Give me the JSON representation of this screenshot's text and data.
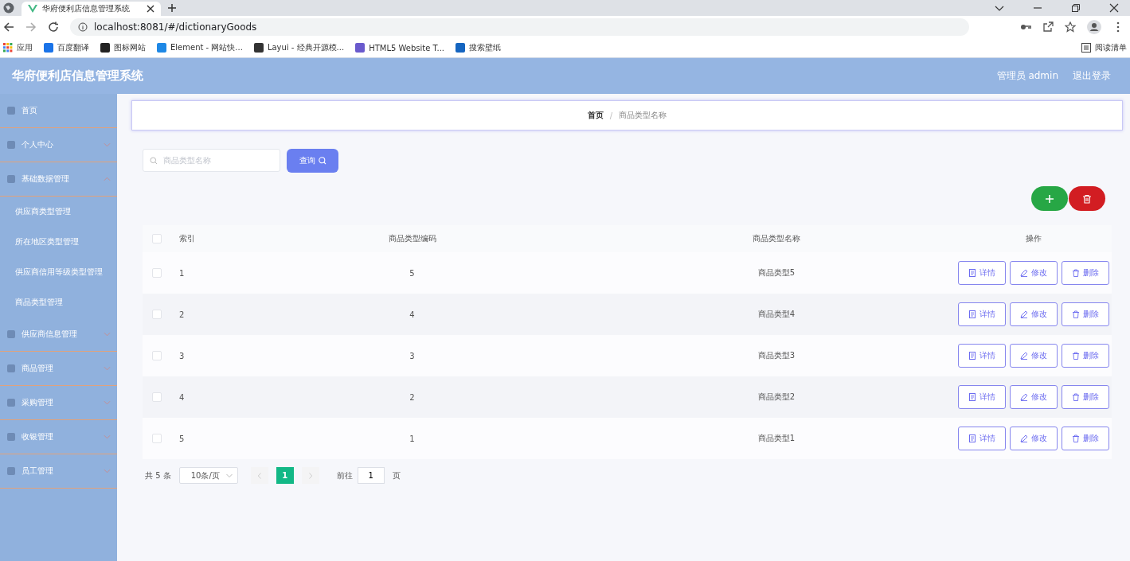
{
  "browser": {
    "tab_title": "华府便利店信息管理系统",
    "url": "localhost:8081/#/dictionaryGoods",
    "bookmarks": [
      "应用",
      "百度翻译",
      "图标网站",
      "Element - 网站快...",
      "Layui - 经典开源模...",
      "HTML5 Website T...",
      "搜索壁纸"
    ],
    "reading_list": "阅读清单"
  },
  "header": {
    "title": "华府便利店信息管理系统",
    "user": "管理员 admin",
    "logout": "退出登录"
  },
  "sidebar": {
    "items": [
      {
        "label": "首页",
        "kind": "link"
      },
      {
        "label": "个人中心",
        "kind": "group",
        "expanded": false
      },
      {
        "label": "基础数据管理",
        "kind": "group",
        "expanded": true,
        "children": [
          {
            "label": "供应商类型管理"
          },
          {
            "label": "所在地区类型管理"
          },
          {
            "label": "供应商信用等级类型管理"
          },
          {
            "label": "商品类型管理"
          }
        ]
      },
      {
        "label": "供应商信息管理",
        "kind": "group",
        "expanded": false
      },
      {
        "label": "商品管理",
        "kind": "group",
        "expanded": false
      },
      {
        "label": "采购管理",
        "kind": "group",
        "expanded": false
      },
      {
        "label": "收银管理",
        "kind": "group",
        "expanded": false
      },
      {
        "label": "员工管理",
        "kind": "group",
        "expanded": false
      }
    ]
  },
  "breadcrumb": {
    "items": [
      "首页",
      "商品类型名称"
    ],
    "separator": "/"
  },
  "search": {
    "placeholder": "商品类型名称",
    "button": "查询"
  },
  "table": {
    "columns": [
      "索引",
      "商品类型编码",
      "商品类型名称",
      "操作"
    ],
    "header_checked": false,
    "rows": [
      {
        "checked": false,
        "cells": [
          "1",
          "5",
          "商品类型5"
        ],
        "actions": [
          "详情",
          "修改",
          "删除"
        ]
      },
      {
        "checked": false,
        "cells": [
          "2",
          "4",
          "商品类型4"
        ],
        "actions": [
          "详情",
          "修改",
          "删除"
        ]
      },
      {
        "checked": false,
        "cells": [
          "3",
          "3",
          "商品类型3"
        ],
        "actions": [
          "详情",
          "修改",
          "删除"
        ]
      },
      {
        "checked": false,
        "cells": [
          "4",
          "2",
          "商品类型2"
        ],
        "actions": [
          "详情",
          "修改",
          "删除"
        ]
      },
      {
        "checked": false,
        "cells": [
          "5",
          "1",
          "商品类型1"
        ],
        "actions": [
          "详情",
          "修改",
          "删除"
        ]
      }
    ]
  },
  "pagination": {
    "total": "共 5 条",
    "page_size": "10条/页",
    "pages": [
      {
        "label": "1",
        "selected": true
      }
    ],
    "goto_label": "前往",
    "goto_value": "1",
    "goto_unit": "页"
  }
}
